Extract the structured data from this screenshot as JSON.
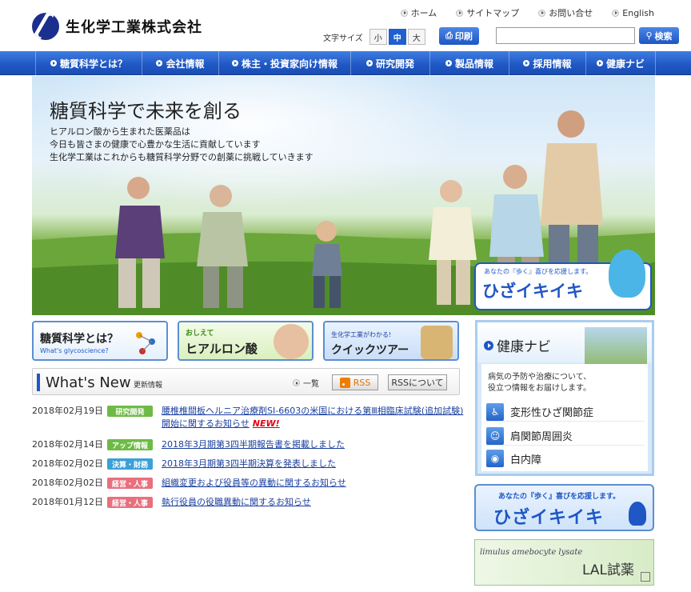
{
  "header": {
    "logo_text": "生化学工業株式会社",
    "toplinks": [
      "ホーム",
      "サイトマップ",
      "お問い合せ",
      "English"
    ],
    "font_size_label": "文字サイズ",
    "font_sizes": [
      "小",
      "中",
      "大"
    ],
    "font_size_selected": "中",
    "print_label": "印刷",
    "search_placeholder": "",
    "search_label": "検索"
  },
  "nav": [
    "糖質科学とは？",
    "会社情報",
    "株主・投資家向け情報",
    "研究開発",
    "製品情報",
    "採用情報",
    "健康ナビ"
  ],
  "hero": {
    "title": "糖質科学で未来を創る",
    "lines": [
      "ヒアルロン酸から生まれた医薬品は",
      "今日も皆さまの健康で心豊かな生活に貢献しています",
      "生化学工業はこれからも糖質科学分野での創薬に挑戦していきます"
    ],
    "badge_small": "あなたの『歩く』喜びを応援します。",
    "badge_big": "ひざイキイキ"
  },
  "banners": {
    "glyco_title": "糖質科学とは？",
    "glyco_sub": "What's glycoscience?",
    "hyal_small": "おしえて",
    "hyal_title": "ヒアルロン酸",
    "quick_small": "生化学工業がわかる!",
    "quick_title": "クイックツアー"
  },
  "whats_new": {
    "title": "What's New",
    "subtitle": "更新情報",
    "list_label": "一覧",
    "rss_label": "RSS",
    "rss_about_label": "RSSについて"
  },
  "news": [
    {
      "date": "2018年02月19日",
      "category": "研究開発",
      "color": "#6dbb45",
      "text": "腰椎椎間板ヘルニア治療剤SI-6603の米国における第Ⅲ相臨床試験(追加試験)開始に関するお知らせ",
      "new": "NEW!"
    },
    {
      "date": "2018年02月14日",
      "category": "アップ情報",
      "color": "#6dbb45",
      "text": "2018年3月期第3四半期報告書を掲載しました",
      "new": ""
    },
    {
      "date": "2018年02月02日",
      "category": "決算・財務",
      "color": "#3aa0d8",
      "text": "2018年3月期第3四半期決算を発表しました",
      "new": ""
    },
    {
      "date": "2018年02月02日",
      "category": "経営・人事",
      "color": "#e8707e",
      "text": "組織変更および役員等の異動に関するお知らせ",
      "new": ""
    },
    {
      "date": "2018年01月12日",
      "category": "経営・人事",
      "color": "#e8707e",
      "text": "執行役員の役職異動に関するお知らせ",
      "new": ""
    }
  ],
  "kenkou_navi": {
    "title": "健康ナビ",
    "desc": [
      "病気の予防や治療について、",
      "役立つ情報をお届けします。"
    ],
    "items": [
      "変形性ひざ関節症",
      "肩関節周囲炎",
      "白内障"
    ]
  },
  "side_banners": {
    "hiza_small": "あなたの『歩く』喜びを応援します。",
    "hiza_big": "ひざイキイキ",
    "lal_small": "limulus amebocyte lysate",
    "lal_big": "LAL試薬"
  }
}
